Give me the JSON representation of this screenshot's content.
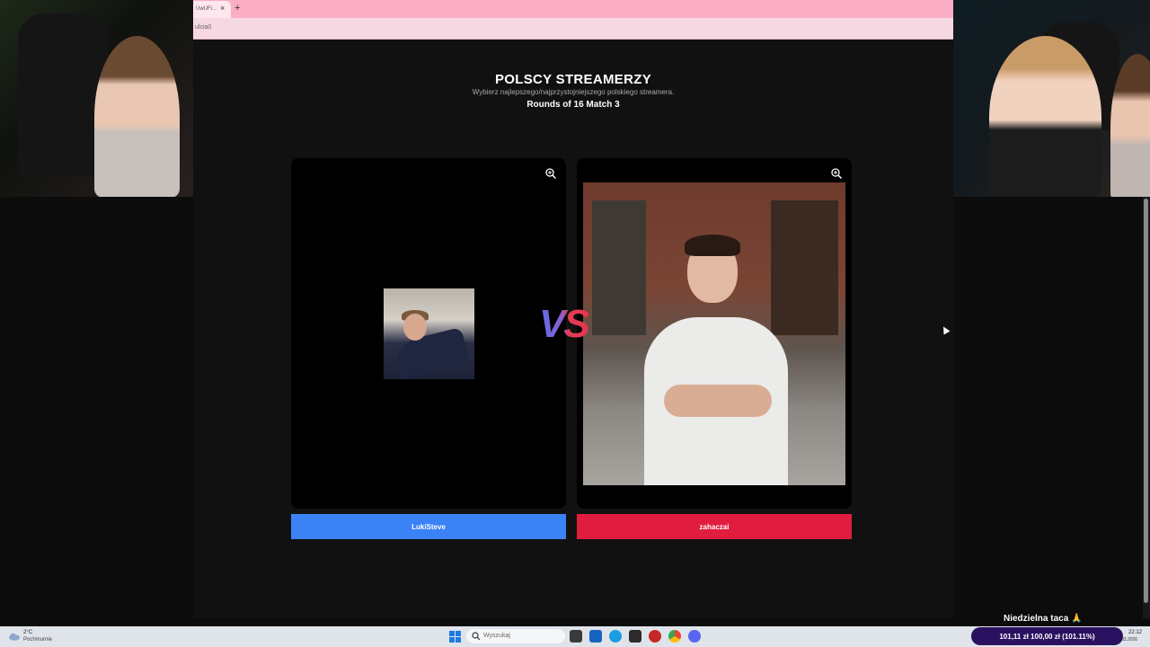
{
  "browser": {
    "tab_title": "UwUFi...",
    "tab_close": "×",
    "new_tab": "+",
    "url": "ulcia0"
  },
  "page": {
    "title": "POLSCY STREAMERZY",
    "subtitle": "Wybierz najlepszego/najprzystojniejszego polskiego streamera.",
    "round": "Rounds of 16 Match 3",
    "vs": "VS"
  },
  "contestants": {
    "left": {
      "name": "LukiSteve",
      "button_color": "#3b82f6"
    },
    "right": {
      "name": "zahaczai",
      "button_color": "#e11d3f"
    }
  },
  "taskbar": {
    "weather_temp": "2°C",
    "weather_desc": "Pochmurnie",
    "search_placeholder": "Wyszukaj",
    "time": "22:12",
    "date": "03.2026"
  },
  "overlay": {
    "label": "Niedzielna taca 🙏",
    "donation": "101,11 zł   100,00 zł (101.11%)",
    "donation_progress": 1.0111
  }
}
